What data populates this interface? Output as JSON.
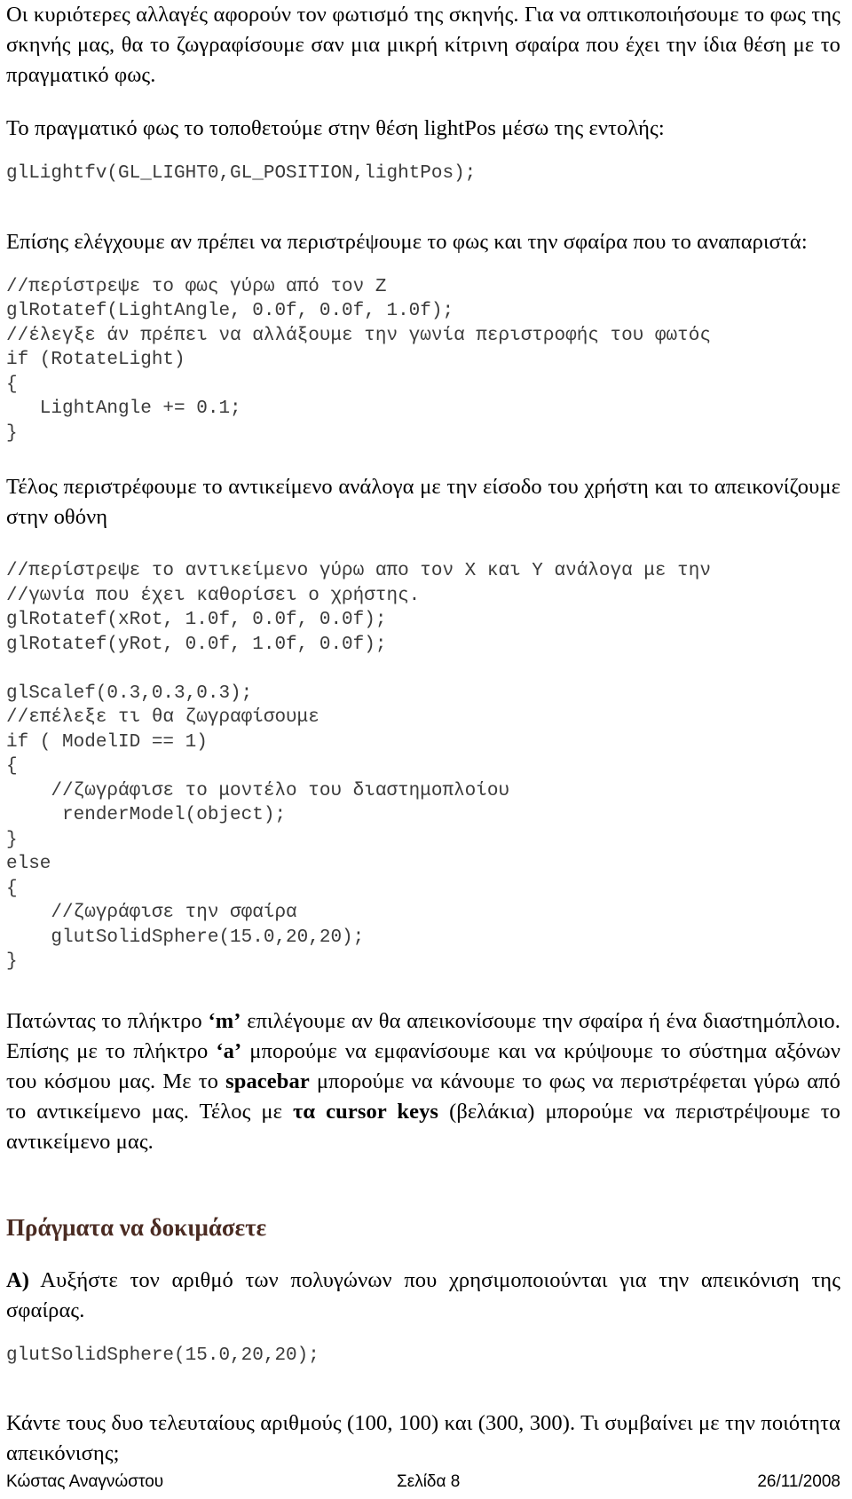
{
  "document": {
    "page_number_label": "Σελίδα 8",
    "author": "Κώστας Αναγνώστου",
    "date": "26/11/2008",
    "heading_color": "#4a2b22",
    "code_color": "#3a3a3a",
    "body_color": "#000000"
  },
  "body": {
    "para_1": "Οι κυριότερες αλλαγές αφορούν τον φωτισμό της σκηνής. Για να οπτικοποιήσουμε το φως της σκηνής μας, θα το ζωγραφίσουμε σαν μια μικρή κίτρινη σφαίρα που έχει την ίδια θέση με το πραγματικό φως.",
    "para_2": "Το πραγματικό φως το τοποθετούμε στην θέση lightPos μέσω της εντολής:",
    "code_1": "glLightfv(GL_LIGHT0,GL_POSITION,lightPos);",
    "para_3": "Επίσης ελέγχουμε αν πρέπει να περιστρέψουμε το φως και την σφαίρα που το αναπαριστά:",
    "code_2": "//περίστρεψε το φως γύρω από τον Z\nglRotatef(LightAngle, 0.0f, 0.0f, 1.0f);\n//έλεγξε άν πρέπει να αλλάξουμε την γωνία περιστροφής του φωτός\nif (RotateLight)\n{\n   LightAngle += 0.1;\n}",
    "para_4": "Τέλος περιστρέφουμε το αντικείμενο ανάλογα με την είσοδο του χρήστη και το απεικονίζουμε στην οθόνη",
    "code_3": "//περίστρεψε το αντικείμενο γύρω απο τον X και Y ανάλογα με την\n//γωνία που έχει καθορίσει ο χρήστης.\nglRotatef(xRot, 1.0f, 0.0f, 0.0f);\nglRotatef(yRot, 0.0f, 1.0f, 0.0f);\n\nglScalef(0.3,0.3,0.3);\n//επέλεξε τι θα ζωγραφίσουμε\nif ( ModelID == 1)\n{\n    //ζωγράφισε το μοντέλο του διαστημοπλοίου\n     renderModel(object);\n}\nelse\n{\n    //ζωγράφισε την σφαίρα\n    glutSolidSphere(15.0,20,20);\n}",
    "para_5_part1": "Πατώντας το πλήκτρο ",
    "para_5_key_m": "‘m’",
    "para_5_part2": " επιλέγουμε αν θα απεικονίσουμε την σφαίρα ή ένα διαστημόπλοιο. Επίσης με το πλήκτρο ",
    "para_5_key_a": "‘a’",
    "para_5_part3": " μπορούμε να εμφανίσουμε και να κρύψουμε το σύστημα αξόνων του κόσμου μας. Με το ",
    "para_5_key_spacebar": "spacebar",
    "para_5_part4": " μπορούμε να κάνουμε το φως να περιστρέφεται γύρω από το αντικείμενο μας. Τέλος με ",
    "para_5_key_cursor": "τα cursor keys",
    "para_5_part5": " (βελάκια) μπορούμε να περιστρέψουμε το αντικείμενο μας."
  },
  "section": {
    "heading": "Πράγματα να δοκιμάσετε",
    "item_a_label": "Α)",
    "item_a_text": " Αυξήστε τον αριθμό των πολυγώνων που χρησιμοποιούνται για την απεικόνιση της σφαίρας.",
    "item_a_code": "glutSolidSphere(15.0,20,20);",
    "item_a_followup": "Κάντε τους δυο τελευταίους αριθμούς (100, 100) και (300, 300). Τι συμβαίνει με την ποιότητα απεικόνισης;"
  }
}
